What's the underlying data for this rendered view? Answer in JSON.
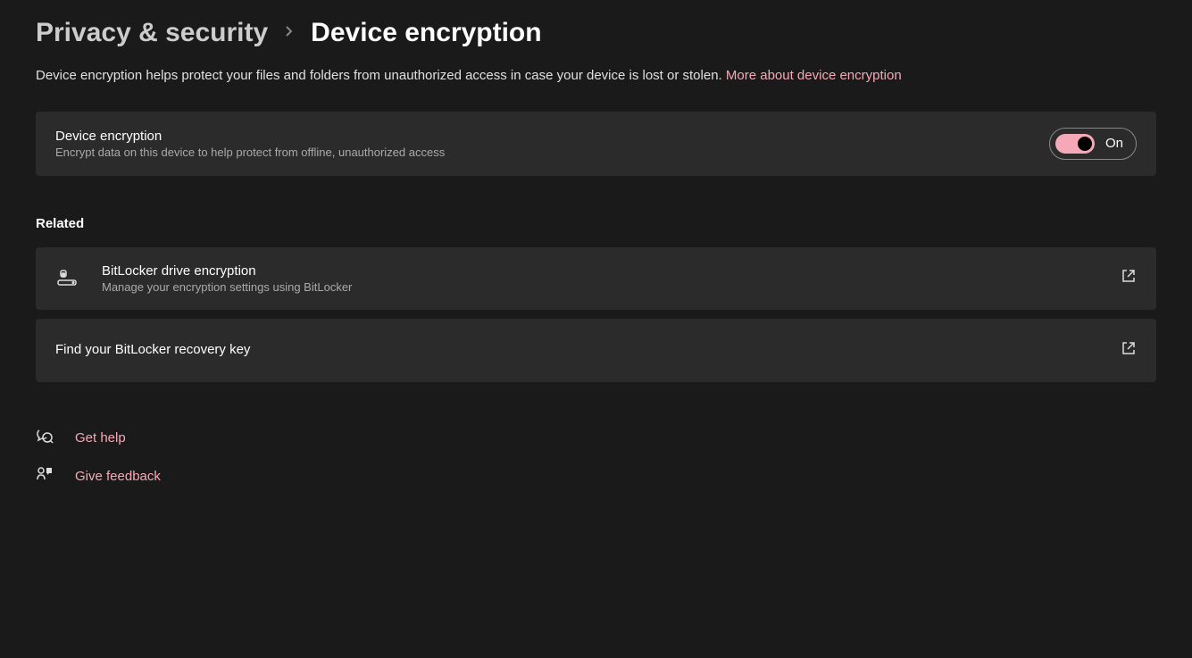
{
  "breadcrumb": {
    "parent": "Privacy & security",
    "current": "Device encryption"
  },
  "description": "Device encryption helps protect your files and folders from unauthorized access in case your device is lost or stolen.",
  "description_link": "More about device encryption",
  "encryption_card": {
    "title": "Device encryption",
    "subtitle": "Encrypt data on this device to help protect from offline, unauthorized access",
    "toggle_state": "On"
  },
  "related_header": "Related",
  "related": [
    {
      "title": "BitLocker drive encryption",
      "subtitle": "Manage your encryption settings using BitLocker"
    },
    {
      "title": "Find your BitLocker recovery key",
      "subtitle": ""
    }
  ],
  "footer": {
    "help": "Get help",
    "feedback": "Give feedback"
  }
}
